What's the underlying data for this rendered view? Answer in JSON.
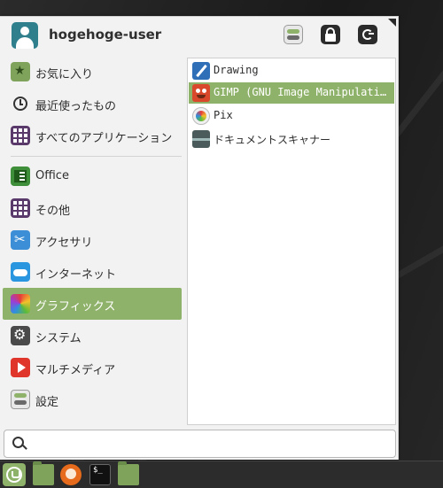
{
  "header": {
    "username": "hogehoge-user",
    "settings_icon": "settings-toggle-icon",
    "lock_icon": "lock-icon",
    "logout_icon": "logout-icon"
  },
  "categories": [
    {
      "label": "お気に入り",
      "icon": "favorites-star-icon"
    },
    {
      "label": "最近使ったもの",
      "icon": "clock-icon"
    },
    {
      "label": "すべてのアプリケーション",
      "icon": "grid-icon"
    },
    {
      "label": "Office",
      "icon": "office-doc-icon"
    },
    {
      "label": "その他",
      "icon": "grid-icon"
    },
    {
      "label": "アクセサリ",
      "icon": "scissors-icon"
    },
    {
      "label": "インターネット",
      "icon": "cloud-icon"
    },
    {
      "label": "グラフィックス",
      "icon": "color-wheel-icon",
      "selected": true
    },
    {
      "label": "システム",
      "icon": "gear-icon"
    },
    {
      "label": "マルチメディア",
      "icon": "play-icon"
    },
    {
      "label": "設定",
      "icon": "toggle-settings-icon"
    }
  ],
  "apps": [
    {
      "label": "Drawing",
      "icon": "drawing-pen-icon"
    },
    {
      "label": "GIMP (GNU Image Manipulati…",
      "icon": "gimp-icon",
      "selected": true
    },
    {
      "label": "Pix",
      "icon": "pix-icon"
    },
    {
      "label": "ドキュメントスキャナー",
      "icon": "scanner-icon"
    }
  ],
  "search": {
    "value": "",
    "placeholder": ""
  },
  "taskbar": {
    "items": [
      "mint-menu-icon",
      "folder-icon",
      "firefox-icon",
      "terminal-icon",
      "folder-icon"
    ]
  },
  "colors": {
    "accent": "#8fb26a",
    "menu_bg": "#f2f2f2",
    "desktop_bg": "#1d1d1d",
    "taskbar_bg": "#2c2c2c"
  }
}
